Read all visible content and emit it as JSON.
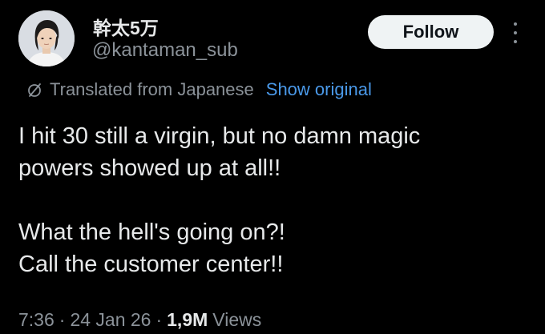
{
  "author": {
    "display_name": "幹太5万",
    "handle": "@kantaman_sub",
    "avatar_icon": "avatar-photo"
  },
  "actions": {
    "follow_label": "Follow",
    "more_icon": "more-vertical-icon"
  },
  "translation": {
    "icon": "translate-icon",
    "notice": "Translated from Japanese",
    "show_original_label": "Show original"
  },
  "tweet": {
    "lines": [
      "I hit 30 still a virgin, but no damn magic",
      "powers showed up at all!!",
      "What the hell's going on?!",
      "Call the customer center!!"
    ]
  },
  "meta": {
    "time": "7:36",
    "date": "24 Jan 26",
    "views_count": "1,9M",
    "views_label": "Views",
    "separator": "·"
  },
  "colors": {
    "background": "#000000",
    "text_primary": "#e7e9ea",
    "text_secondary": "#8b9299",
    "link": "#4a99e9",
    "follow_button_bg": "#eff3f4"
  }
}
